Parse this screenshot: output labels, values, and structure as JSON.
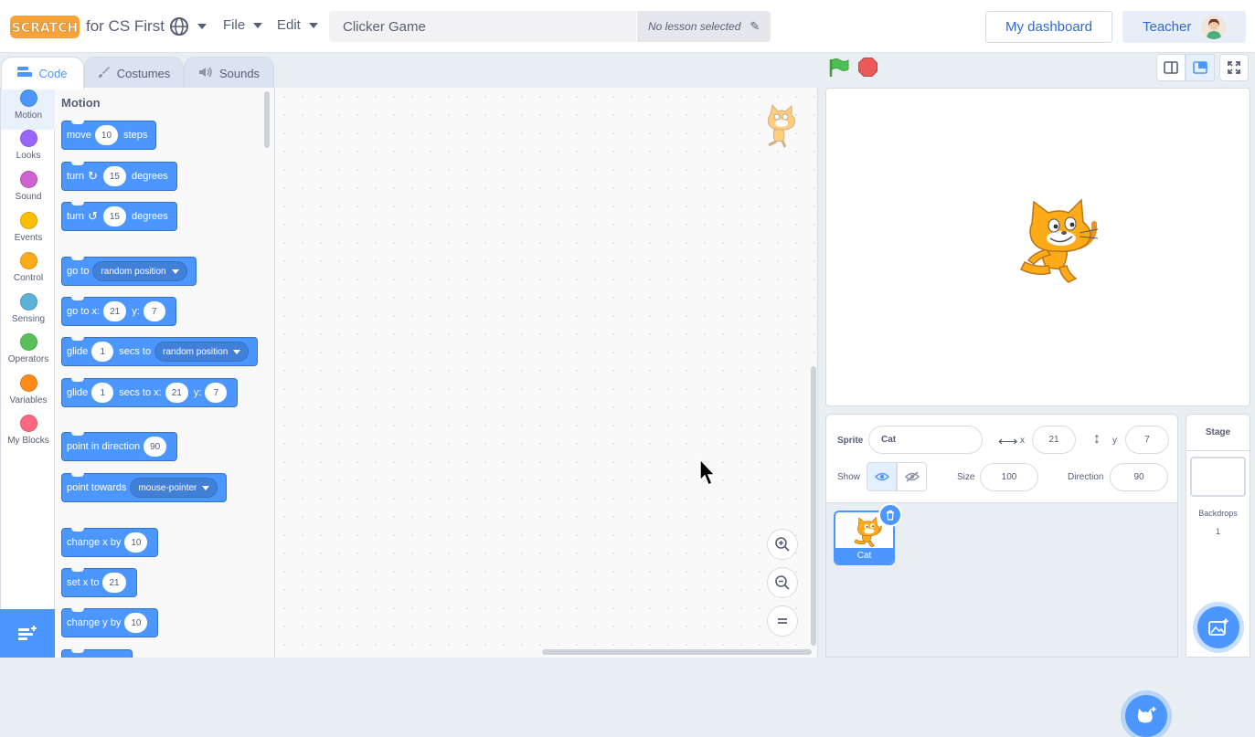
{
  "menu_bar": {
    "logo_text": "SCRATCH",
    "brand_suffix": "for CS First",
    "language_icon": "globe-icon",
    "file_label": "File",
    "edit_label": "Edit",
    "project_title": "Clicker Game",
    "lesson_text": "No lesson selected",
    "dashboard_label": "My dashboard",
    "teacher_label": "Teacher"
  },
  "tabs": [
    {
      "label": "Code",
      "icon": "code-icon"
    },
    {
      "label": "Costumes",
      "icon": "brush-icon"
    },
    {
      "label": "Sounds",
      "icon": "speaker-icon"
    }
  ],
  "categories": [
    {
      "label": "Motion",
      "color": "#4c97ff"
    },
    {
      "label": "Looks",
      "color": "#9966ff"
    },
    {
      "label": "Sound",
      "color": "#cf63cf"
    },
    {
      "label": "Events",
      "color": "#ffbf00"
    },
    {
      "label": "Control",
      "color": "#ffab19"
    },
    {
      "label": "Sensing",
      "color": "#5cb1d6"
    },
    {
      "label": "Operators",
      "color": "#59c059"
    },
    {
      "label": "Variables",
      "color": "#ff8c1a"
    },
    {
      "label": "My Blocks",
      "color": "#ff6680"
    }
  ],
  "palette": {
    "heading": "Motion",
    "blocks": {
      "move": {
        "t1": "move",
        "v1": "10",
        "t2": "steps"
      },
      "turn_right": {
        "t1": "turn",
        "v1": "15",
        "t2": "degrees"
      },
      "turn_left": {
        "t1": "turn",
        "v1": "15",
        "t2": "degrees"
      },
      "go_to": {
        "t1": "go to",
        "dd": "random position"
      },
      "go_to_xy": {
        "t1": "go to x:",
        "v1": "21",
        "t2": "y:",
        "v2": "7"
      },
      "glide_to": {
        "t1": "glide",
        "v1": "1",
        "t2": "secs to",
        "dd": "random position"
      },
      "glide_xy": {
        "t1": "glide",
        "v1": "1",
        "t2": "secs to x:",
        "v2": "21",
        "t3": "y:",
        "v3": "7"
      },
      "point_dir": {
        "t1": "point in direction",
        "v1": "90"
      },
      "point_towards": {
        "t1": "point towards",
        "dd": "mouse-pointer"
      },
      "change_x": {
        "t1": "change x by",
        "v1": "10"
      },
      "set_x": {
        "t1": "set x to",
        "v1": "21"
      },
      "change_y": {
        "t1": "change y by",
        "v1": "10"
      }
    }
  },
  "sprite_info": {
    "sprite_label": "Sprite",
    "sprite_name": "Cat",
    "x_label": "x",
    "x_value": "21",
    "y_label": "y",
    "y_value": "7",
    "show_label": "Show",
    "size_label": "Size",
    "size_value": "100",
    "direction_label": "Direction",
    "direction_value": "90"
  },
  "sprites": [
    {
      "name": "Cat"
    }
  ],
  "stage_selector": {
    "title": "Stage",
    "backdrops_label": "Backdrops",
    "backdrops_count": "1"
  },
  "colors": {
    "accent": "#4c97ff",
    "motion_block": "#4c97ff",
    "background": "#e9eef2"
  }
}
